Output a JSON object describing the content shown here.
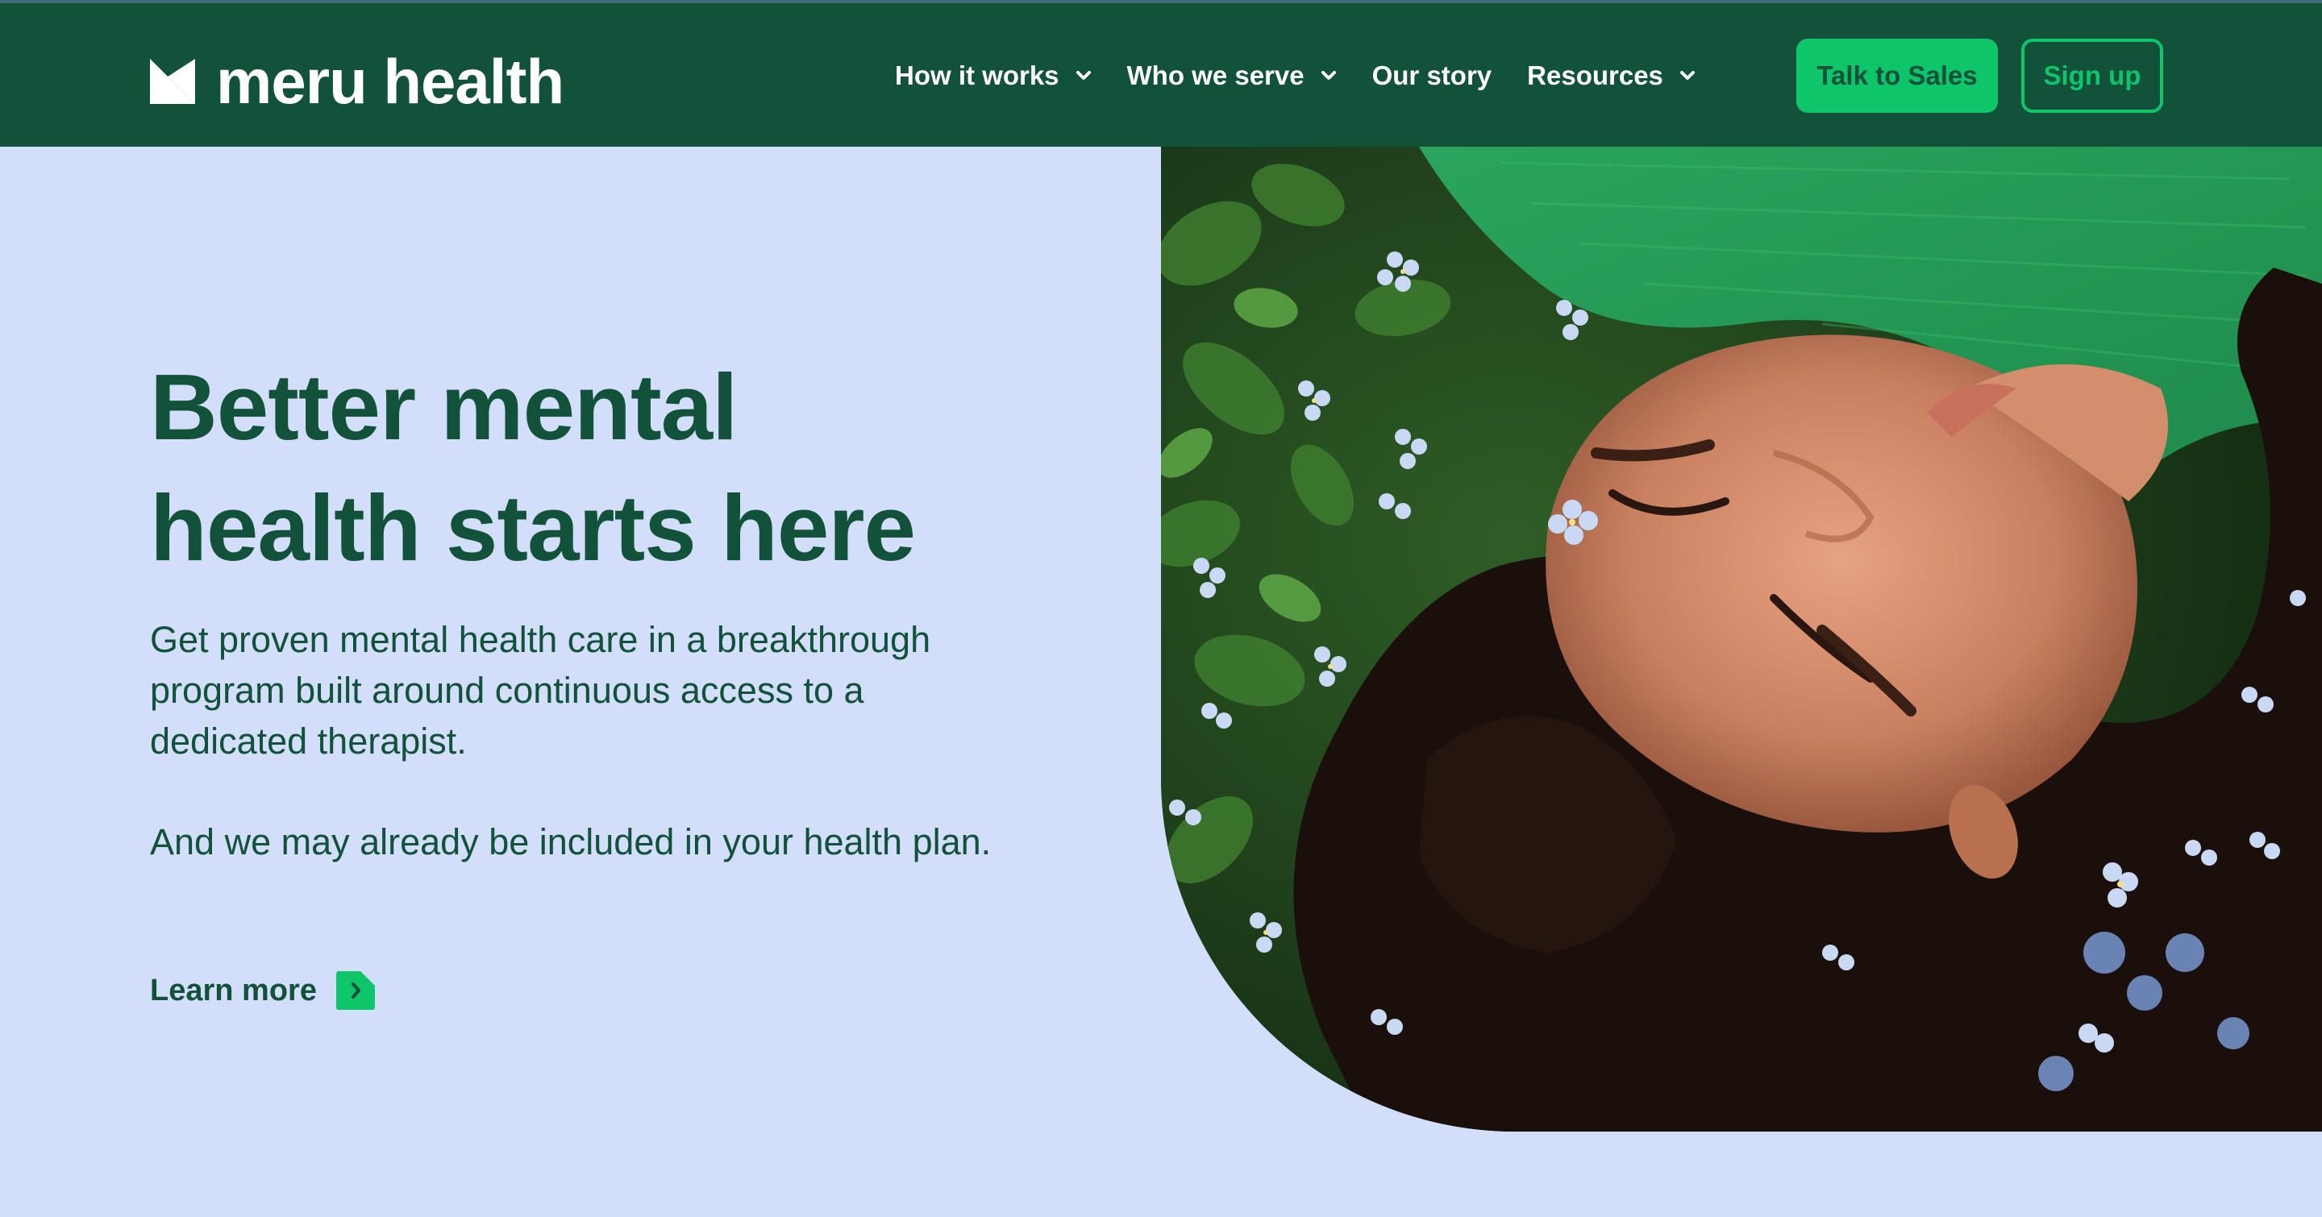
{
  "brand": {
    "name": "meru health",
    "logo_icon": "meru-logo-mark"
  },
  "nav": {
    "items": [
      {
        "label": "How it works",
        "has_dropdown": true
      },
      {
        "label": "Who we serve",
        "has_dropdown": true
      },
      {
        "label": "Our story",
        "has_dropdown": false
      },
      {
        "label": "Resources",
        "has_dropdown": true
      }
    ],
    "talk_to_sales": "Talk to Sales",
    "sign_up": "Sign up"
  },
  "hero": {
    "headline_line1": "Better mental",
    "headline_line2": "health starts here",
    "paragraph1": "Get proven mental health care in a breakthrough program built around continuous access to a dedicated therapist.",
    "paragraph2": "And we may already be included in your health plan.",
    "learn_more": "Learn more",
    "image_alt": "woman-lying-in-flowers-photo"
  },
  "colors": {
    "nav_bg": "#12513a",
    "accent_green": "#0ec56a",
    "hero_bg": "#d2defa",
    "text_dark_green": "#12513a"
  }
}
